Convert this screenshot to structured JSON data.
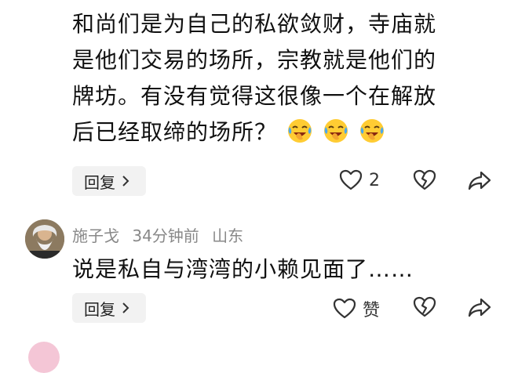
{
  "comment1": {
    "lines": [
      "和尚们是为自己的私欲敛财，寺庙就",
      "是他们交易的场所，宗教就是他们的",
      "牌坊。有没有觉得这很像一个在解放",
      "后已经取缔的场所？"
    ],
    "reply_label": "回复",
    "like_count": "2"
  },
  "comment2": {
    "username": "施子戈",
    "time": "34分钟前",
    "location": "山东",
    "text": "说是私自与湾湾的小赖见面了……",
    "reply_label": "回复",
    "like_label": "赞"
  },
  "icons": {
    "emoji": "crying-laughing-emoji",
    "like": "heart-outline-icon",
    "dislike": "broken-heart-icon",
    "share": "share-arrow-icon",
    "chevron": "chevron-right-icon"
  },
  "colors": {
    "text": "#111111",
    "meta": "#888888",
    "button_bg": "#f2f2f2"
  }
}
